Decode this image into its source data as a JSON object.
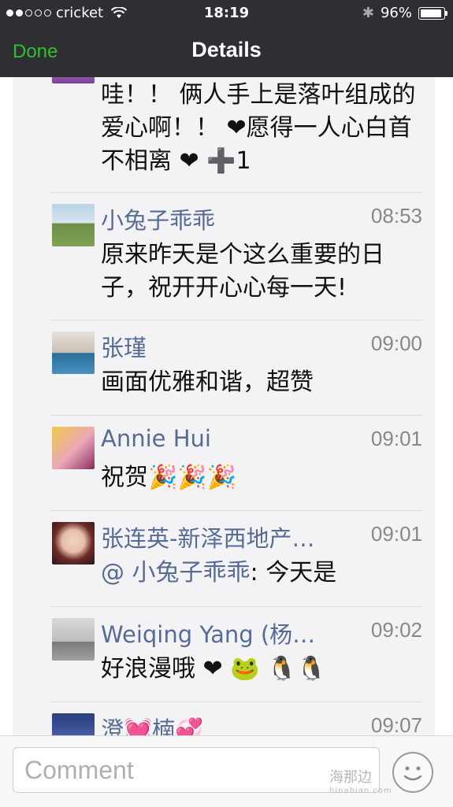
{
  "status_bar": {
    "carrier": "cricket",
    "time": "18:19",
    "battery": "96%",
    "battery_level": 0.96,
    "signal_bars": 2
  },
  "nav": {
    "done_label": "Done",
    "title": "Details"
  },
  "first_comment_text": "哇！！ 俩人手上是落叶组成的爱心啊！！ ❤愿得一人心白首不相离 ❤ ➕1",
  "comments": [
    {
      "name": "小兔子乖乖",
      "time": "08:53",
      "text": "原来昨天是个这么重要的日子，祝开开心心每一天!"
    },
    {
      "name": "张瑾",
      "time": "09:00",
      "text": "画面优雅和谐，超赞"
    },
    {
      "name": "Annie Hui",
      "time": "09:01",
      "text": "祝贺🎉🎉🎉"
    },
    {
      "name": "张连英-新泽西地产…",
      "time": "09:01",
      "mention": "@ 小兔子乖乖",
      "text": ": 今天是"
    },
    {
      "name": "Weiqing Yang (杨…",
      "time": "09:02",
      "text": "好浪漫哦 ❤ 🐸 🐧🐧"
    },
    {
      "name": "澄💓楠💞",
      "time": "09:07",
      "text": ""
    }
  ],
  "comment_bar": {
    "placeholder": "Comment",
    "watermark": "海那边",
    "watermark_url": "hinabian.com"
  }
}
